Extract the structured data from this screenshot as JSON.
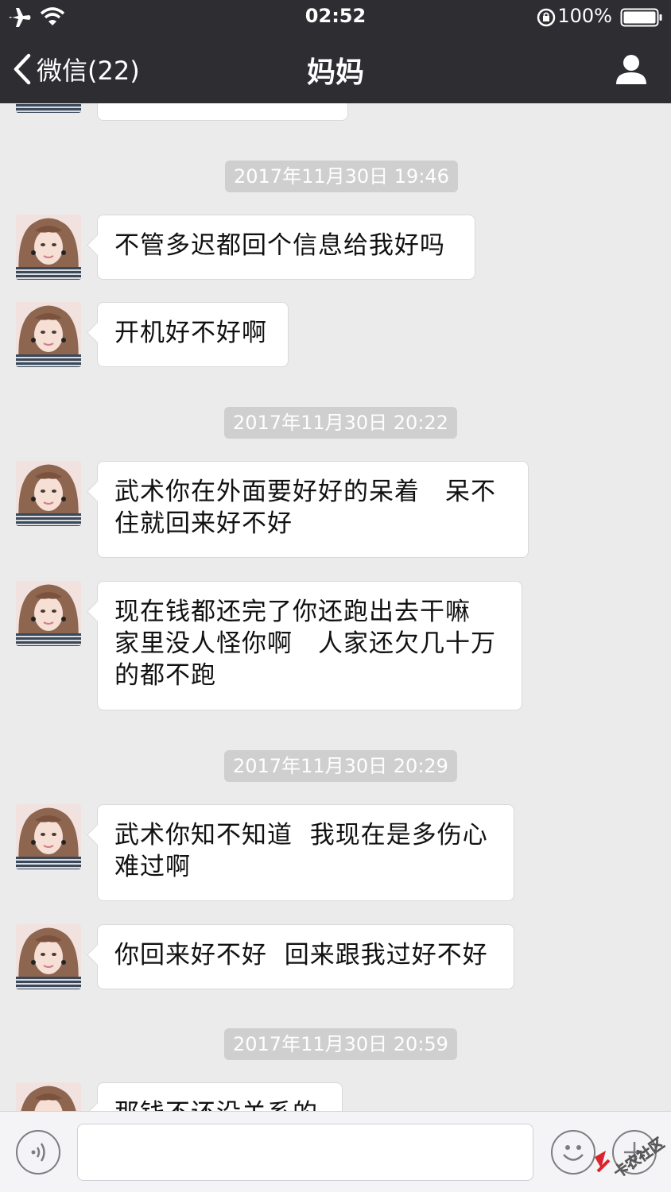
{
  "status_bar": {
    "time": "02:52",
    "battery_percent": "100%"
  },
  "nav": {
    "back_label": "微信(22)",
    "title": "妈妈"
  },
  "chat": {
    "messages": [
      {
        "type": "timestamp",
        "text": "2017年11月30日 19:46"
      },
      {
        "type": "received",
        "text": "不管多迟都回个信息给我好吗"
      },
      {
        "type": "received",
        "text": "开机好不好啊"
      },
      {
        "type": "timestamp",
        "text": "2017年11月30日 20:22"
      },
      {
        "type": "received",
        "text": "武术你在外面要好好的呆着　呆不\n住就回来好不好"
      },
      {
        "type": "received",
        "text": "现在钱都还完了你还跑出去干嘛\n家里没人怪你啊　人家还欠几十万\n的都不跑"
      },
      {
        "type": "timestamp",
        "text": "2017年11月30日 20:29"
      },
      {
        "type": "received",
        "text": "武术你知不知道  我现在是多伤心\n难过啊"
      },
      {
        "type": "received",
        "text": "你回来好不好  回来跟我过好不好"
      },
      {
        "type": "timestamp",
        "text": "2017年11月30日 20:59"
      },
      {
        "type": "received",
        "text": "那钱不还没关系的"
      }
    ]
  },
  "watermark": {
    "text": "卡农社区"
  },
  "colors": {
    "nav_bg": "#2e2d32",
    "chat_bg": "#ebebeb",
    "bubble": "#ffffff",
    "timestamp_bg": "#cfcfcf"
  }
}
